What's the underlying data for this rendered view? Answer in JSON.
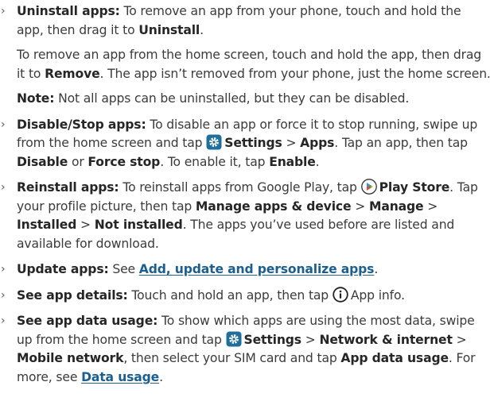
{
  "colors": {
    "link": "#1a5f8f",
    "settings_icon_bg": "#1f6f9a"
  },
  "icons": {
    "settings": "gear-icon",
    "play_store": "play-store-icon",
    "info": "info-icon",
    "bullet": "›"
  },
  "uninstall": {
    "title": "Uninstall apps:",
    "t1": " To remove an app from your phone, touch and hold the app, then drag it to ",
    "b1": "Uninstall",
    "t2": "."
  },
  "home_remove": {
    "t1": "To remove an app from the home screen, touch and hold the app, then drag it to ",
    "b1": "Remove",
    "t2": ". The app isn’t removed from your phone, just the home screen."
  },
  "note": {
    "label": "Note:",
    "text": " Not all apps can be uninstalled, but they can be disabled."
  },
  "disable": {
    "title": "Disable/Stop apps:",
    "t1": " To disable an app or force it to stop running, swipe up from the home screen and tap ",
    "settings": "Settings",
    "sep1": " > ",
    "apps": "Apps",
    "t2": ". Tap an app, then tap ",
    "disable": "Disable",
    "or": " or ",
    "force": "Force stop",
    "t3": ". To enable it, tap ",
    "enable": "Enable",
    "t4": "."
  },
  "reinstall": {
    "title": "Reinstall apps:",
    "t1": " To reinstall apps from Google Play, tap ",
    "play": "Play Store",
    "t2": ". Tap your profile picture, then tap ",
    "manage_dev": "Manage apps & device",
    "sep1": " > ",
    "manage": "Manage",
    "sep2": " > ",
    "installed": "Installed",
    "sep3": " > ",
    "not_installed": "Not installed",
    "t3": ". The apps you’ve used before are listed and available for download."
  },
  "update": {
    "title": "Update apps:",
    "t1": " See ",
    "link": "Add, update and personalize apps",
    "t2": "."
  },
  "details": {
    "title": "See app details:",
    "t1": " Touch and hold an app, then tap ",
    "app_info": "App info."
  },
  "data_usage": {
    "title": "See app data usage:",
    "t1": " To show which apps are using the most data, swipe up from the home screen and tap ",
    "settings": "Settings",
    "sep1": " > ",
    "network": "Network & internet",
    "sep2": " > ",
    "mobile": "Mobile network",
    "t2": ", then select your SIM card and tap ",
    "app_data": "App data usage",
    "t3": ". For more, see ",
    "link": "Data usage",
    "t4": "."
  }
}
